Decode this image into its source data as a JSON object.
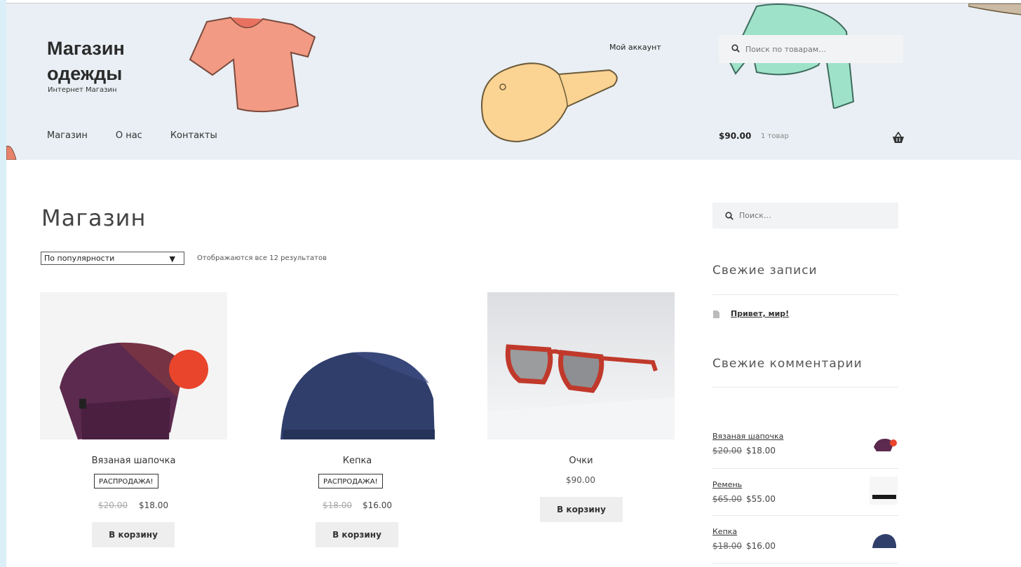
{
  "site": {
    "title": "Магазин одежды",
    "description": "Интернет Магазин"
  },
  "nav": {
    "items": [
      "Магазин",
      "О нас",
      "Контакты"
    ]
  },
  "header": {
    "account_label": "Мой аккаунт",
    "search_placeholder": "Поиск по товарам…",
    "cart_total": "$90.00",
    "cart_count": "1 товар"
  },
  "page": {
    "title": "Магазин",
    "orderby_selected": "По популярности",
    "result_count": "Отображаются все 12 результатов"
  },
  "products": [
    {
      "name": "Вязаная шапочка",
      "badge": "Распродажа!",
      "price_old": "$20.00",
      "price_new": "$18.00",
      "button": "В корзину"
    },
    {
      "name": "Кепка",
      "badge": "Распродажа!",
      "price_old": "$18.00",
      "price_new": "$16.00",
      "button": "В корзину"
    },
    {
      "name": "Очки",
      "price": "$90.00",
      "button": "В корзину"
    }
  ],
  "sidebar": {
    "search_placeholder": "Поиск…",
    "recent_posts_title": "Свежие записи",
    "recent_posts": [
      "Привет, мир!"
    ],
    "recent_comments_title": "Свежие комментарии",
    "products": [
      {
        "name": "Вязаная шапочка",
        "price_old": "$20.00",
        "price_new": "$18.00"
      },
      {
        "name": "Ремень",
        "price_old": "$65.00",
        "price_new": "$55.00"
      },
      {
        "name": "Кепка",
        "price_old": "$18.00",
        "price_new": "$16.00"
      }
    ]
  },
  "icons": {
    "search": "search-icon",
    "cart": "basket-icon",
    "select_arrow": "▼",
    "post": "document-icon"
  },
  "colors": {
    "header_bg": "#e9eff4",
    "button_bg": "#eeeeee",
    "left_strip": "#dbeff8"
  }
}
